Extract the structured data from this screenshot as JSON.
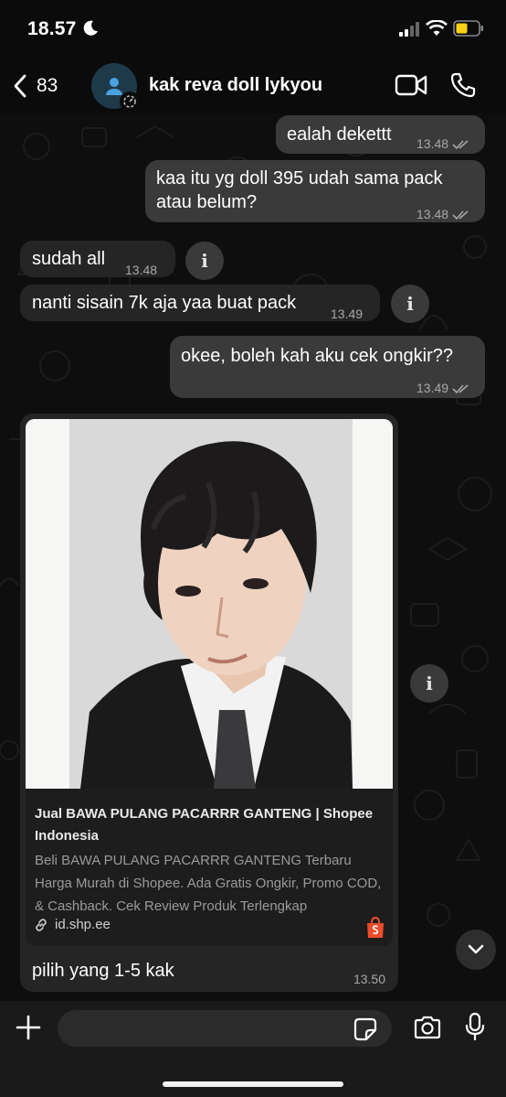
{
  "status_bar": {
    "time": "18.57"
  },
  "header": {
    "back_count": "83",
    "contact_name": "kak reva doll lykyou"
  },
  "messages": [
    {
      "text": "ealah dekettt",
      "time": "13.48"
    },
    {
      "text": "kaa itu yg doll 395 udah sama pack\natau belum?",
      "time": "13.48"
    },
    {
      "text": "sudah all",
      "time": "13.48"
    },
    {
      "text": "nanti sisain 7k aja yaa buat pack",
      "time": "13.49"
    },
    {
      "text": "okee, boleh kah aku cek ongkir??",
      "time": "13.49"
    }
  ],
  "link_preview": {
    "title": "Jual BAWA PULANG PACARRR GANTENG | Shopee Indonesia",
    "description": "Beli BAWA PULANG PACARRR GANTENG Terbaru Harga Murah di Shopee. Ada Gratis Ongkir, Promo COD, & Cashback. Cek Review Produk Terlengkap",
    "domain": "id.shp.ee",
    "caption": "pilih yang 1-5 kak",
    "time": "13.50"
  },
  "input": {
    "placeholder": "",
    "value": ""
  },
  "colors": {
    "outgoing_bubble": "#3a3a3a",
    "incoming_bubble": "#252525",
    "shopee_orange": "#ee4d2d",
    "battery_yellow": "#f6d117"
  }
}
